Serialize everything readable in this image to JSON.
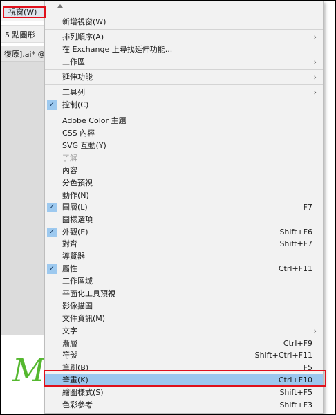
{
  "menubar": {
    "view_menu": "視窗(W)"
  },
  "toolbar": {
    "shape_label": "5 點圓形"
  },
  "doc_tab": {
    "label": "復原].ai* @"
  },
  "menu_items": [
    {
      "label": "新增視窗(W)",
      "shortcut": "",
      "submenu": false,
      "checked": false,
      "disabled": false,
      "highlighted": false
    },
    {
      "label": "排列順序(A)",
      "shortcut": "",
      "submenu": true,
      "checked": false,
      "disabled": false,
      "highlighted": false
    },
    {
      "label": "在 Exchange 上尋找延伸功能...",
      "shortcut": "",
      "submenu": false,
      "checked": false,
      "disabled": false,
      "highlighted": false
    },
    {
      "label": "工作區",
      "shortcut": "",
      "submenu": true,
      "checked": false,
      "disabled": false,
      "highlighted": false
    },
    {
      "label": "延伸功能",
      "shortcut": "",
      "submenu": true,
      "checked": false,
      "disabled": false,
      "highlighted": false
    },
    {
      "label": "工具列",
      "shortcut": "",
      "submenu": true,
      "checked": false,
      "disabled": false,
      "highlighted": false
    },
    {
      "label": "控制(C)",
      "shortcut": "",
      "submenu": false,
      "checked": true,
      "disabled": false,
      "highlighted": false
    },
    {
      "label": "Adobe Color 主題",
      "shortcut": "",
      "submenu": false,
      "checked": false,
      "disabled": false,
      "highlighted": false
    },
    {
      "label": "CSS 內容",
      "shortcut": "",
      "submenu": false,
      "checked": false,
      "disabled": false,
      "highlighted": false
    },
    {
      "label": "SVG 互動(Y)",
      "shortcut": "",
      "submenu": false,
      "checked": false,
      "disabled": false,
      "highlighted": false
    },
    {
      "label": "了解",
      "shortcut": "",
      "submenu": false,
      "checked": false,
      "disabled": true,
      "highlighted": false
    },
    {
      "label": "內容",
      "shortcut": "",
      "submenu": false,
      "checked": false,
      "disabled": false,
      "highlighted": false
    },
    {
      "label": "分色預視",
      "shortcut": "",
      "submenu": false,
      "checked": false,
      "disabled": false,
      "highlighted": false
    },
    {
      "label": "動作(N)",
      "shortcut": "",
      "submenu": false,
      "checked": false,
      "disabled": false,
      "highlighted": false
    },
    {
      "label": "圖層(L)",
      "shortcut": "F7",
      "submenu": false,
      "checked": true,
      "disabled": false,
      "highlighted": false
    },
    {
      "label": "圖樣選項",
      "shortcut": "",
      "submenu": false,
      "checked": false,
      "disabled": false,
      "highlighted": false
    },
    {
      "label": "外觀(E)",
      "shortcut": "Shift+F6",
      "submenu": false,
      "checked": true,
      "disabled": false,
      "highlighted": false
    },
    {
      "label": "對齊",
      "shortcut": "Shift+F7",
      "submenu": false,
      "checked": false,
      "disabled": false,
      "highlighted": false
    },
    {
      "label": "導覽器",
      "shortcut": "",
      "submenu": false,
      "checked": false,
      "disabled": false,
      "highlighted": false
    },
    {
      "label": "屬性",
      "shortcut": "Ctrl+F11",
      "submenu": false,
      "checked": true,
      "disabled": false,
      "highlighted": false
    },
    {
      "label": "工作區域",
      "shortcut": "",
      "submenu": false,
      "checked": false,
      "disabled": false,
      "highlighted": false
    },
    {
      "label": "平面化工具預視",
      "shortcut": "",
      "submenu": false,
      "checked": false,
      "disabled": false,
      "highlighted": false
    },
    {
      "label": "影像描圖",
      "shortcut": "",
      "submenu": false,
      "checked": false,
      "disabled": false,
      "highlighted": false
    },
    {
      "label": "文件資訊(M)",
      "shortcut": "",
      "submenu": false,
      "checked": false,
      "disabled": false,
      "highlighted": false
    },
    {
      "label": "文字",
      "shortcut": "",
      "submenu": true,
      "checked": false,
      "disabled": false,
      "highlighted": false
    },
    {
      "label": "漸層",
      "shortcut": "Ctrl+F9",
      "submenu": false,
      "checked": false,
      "disabled": false,
      "highlighted": false
    },
    {
      "label": "符號",
      "shortcut": "Shift+Ctrl+F11",
      "submenu": false,
      "checked": false,
      "disabled": false,
      "highlighted": false
    },
    {
      "label": "筆刷(B)",
      "shortcut": "F5",
      "submenu": false,
      "checked": false,
      "disabled": false,
      "highlighted": false
    },
    {
      "label": "筆畫(K)",
      "shortcut": "Ctrl+F10",
      "submenu": false,
      "checked": false,
      "disabled": false,
      "highlighted": true
    },
    {
      "label": "繪圖樣式(S)",
      "shortcut": "Shift+F5",
      "submenu": false,
      "checked": false,
      "disabled": false,
      "highlighted": false
    },
    {
      "label": "色彩參考",
      "shortcut": "Shift+F3",
      "submenu": false,
      "checked": false,
      "disabled": false,
      "highlighted": false
    }
  ],
  "colors": {
    "highlight": "#9cc7ee",
    "annotation_red": "#e0101b",
    "check_bg": "#9dc9ef",
    "menu_bg": "#f2f2f2"
  }
}
